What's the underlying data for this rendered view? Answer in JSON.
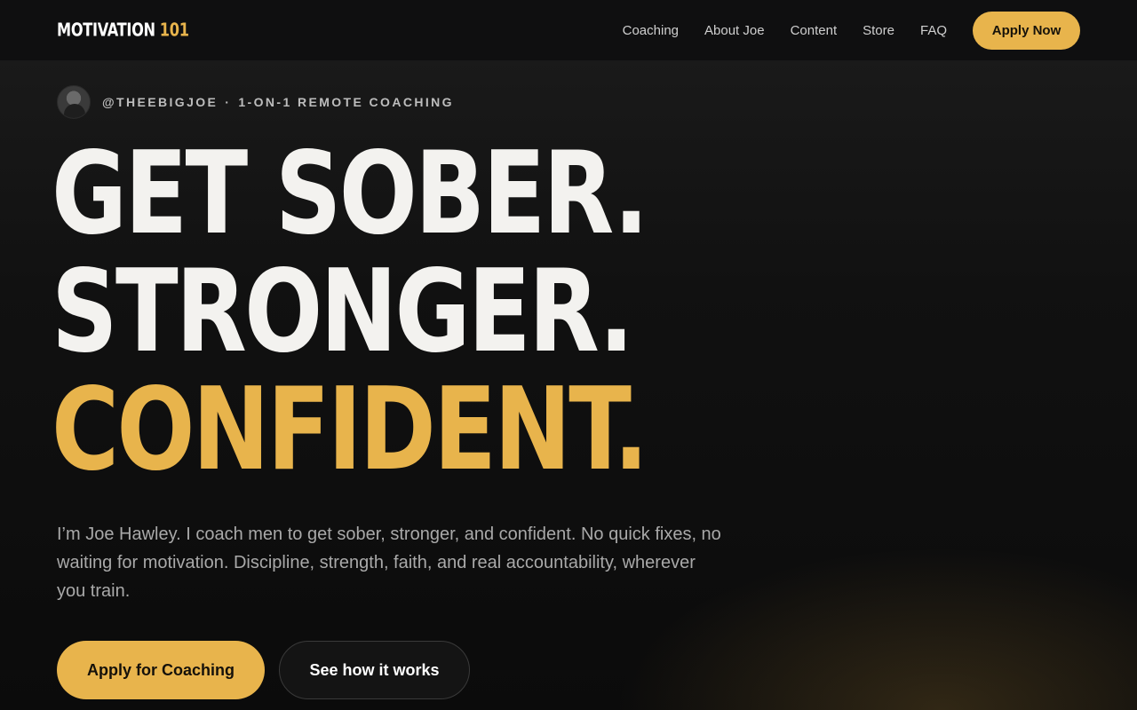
{
  "nav": {
    "logo_main": "MOTIVATION",
    "logo_accent": "101",
    "links": [
      "Coaching",
      "About Joe",
      "Content",
      "Store",
      "FAQ"
    ],
    "cta_label": "Apply Now"
  },
  "hero": {
    "handle": "@THEEBIGJOE",
    "separator": "·",
    "tagline": "1-ON-1 REMOTE COACHING",
    "headline_lines": [
      "GET SOBER.",
      "STRONGER.",
      "CONFIDENT."
    ],
    "subtitle": "I’m Joe Hawley. I coach men to get sober, stronger, and confident. No quick fixes, no waiting for motivation. Discipline, strength, faith, and real accountability, wherever you train.",
    "primary_button": "Apply for Coaching",
    "secondary_button": "See how it works"
  },
  "theme": {
    "accent": "#e8b44c",
    "background": "#0d0d0d"
  }
}
